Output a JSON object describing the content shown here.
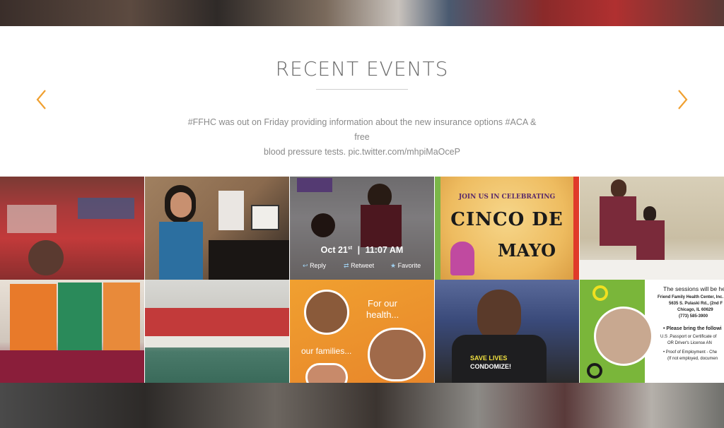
{
  "events": {
    "heading": "RECENT EVENTS",
    "tweet_line1": "#FFHC was out on Friday providing information about the new insurance options #ACA & free",
    "tweet_line2": "blood pressure tests. pic.twitter.com/mhpiMaOceP"
  },
  "hover": {
    "date": "Oct 21",
    "date_sup": "st",
    "sep": "|",
    "time": "11:07 AM",
    "reply": "Reply",
    "retweet": "Retweet",
    "favorite": "Favorite"
  },
  "cinco": {
    "top": "JOIN US IN CELEBRATING",
    "title1": "CINCO DE",
    "title2": "MAYO"
  },
  "flyer": {
    "line1": "For our",
    "line2": "health...",
    "line3": "our families..."
  },
  "shirt": {
    "line1": "SAVE LIVES",
    "line2": "CONDOMIZE!"
  },
  "sessions": {
    "held": "The sessions will be held",
    "org": "Friend Family Health Center, Inc.",
    "address": "5635 S. Pulaski Rd., (2nd F",
    "city": "Chicago, IL 60629",
    "phone": "(773) 585-3900",
    "bring": "Please bring the followi",
    "passport": "U.S .Passport or Certificate of",
    "license": "OR Driver's License AN",
    "employment": "Proof of Employment - Che",
    "not_employed": "(If not employed, documen"
  },
  "colors": {
    "accent": "#f0a030",
    "heading": "#6b6b6b",
    "body_text": "#8a8a8a"
  }
}
